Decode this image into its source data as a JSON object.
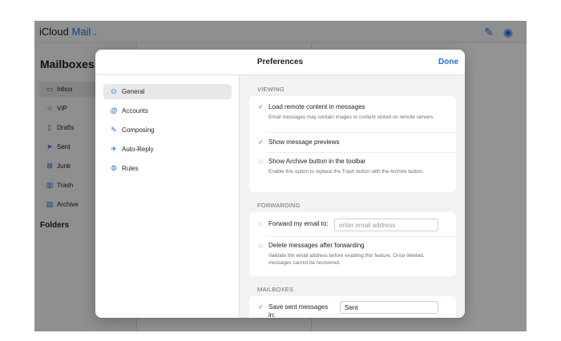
{
  "app": {
    "brand_prefix": "iCloud",
    "brand_product": "Mail",
    "brand_chevron": "⌄",
    "mailboxes_title": "Mailboxes",
    "folders_title": "Folders",
    "mailboxes": [
      {
        "label": "Inbox",
        "icon": "inbox-icon",
        "glyph": "▭"
      },
      {
        "label": "VIP",
        "icon": "star-icon",
        "glyph": "☆"
      },
      {
        "label": "Drafts",
        "icon": "draft-icon",
        "glyph": "▯"
      },
      {
        "label": "Sent",
        "icon": "paper-plane-icon",
        "glyph": "➤"
      },
      {
        "label": "Junk",
        "icon": "junk-icon",
        "glyph": "⊠"
      },
      {
        "label": "Trash",
        "icon": "trash-icon",
        "glyph": "▥"
      },
      {
        "label": "Archive",
        "icon": "archive-icon",
        "glyph": "▤"
      }
    ]
  },
  "modal": {
    "title": "Preferences",
    "done_label": "Done",
    "nav": [
      {
        "label": "General",
        "icon": "gear-icon",
        "glyph": "⊙"
      },
      {
        "label": "Accounts",
        "icon": "at-icon",
        "glyph": "@"
      },
      {
        "label": "Composing",
        "icon": "compose-icon",
        "glyph": "✎"
      },
      {
        "label": "Auto-Reply",
        "icon": "plane-icon",
        "glyph": "✈"
      },
      {
        "label": "Rules",
        "icon": "rules-icon",
        "glyph": "⚙"
      }
    ]
  },
  "viewing": {
    "header": "VIEWING",
    "load_remote": {
      "label": "Load remote content in messages",
      "checked": true,
      "desc": "Email messages may contain images or content stored on remote servers."
    },
    "previews": {
      "label": "Show message previews",
      "checked": true
    },
    "archive_btn": {
      "label": "Show Archive button in the toolbar",
      "checked": false,
      "desc": "Enable this option to replace the Trash button with the Archive button."
    }
  },
  "forwarding": {
    "header": "FORWARDING",
    "forward": {
      "label": "Forward my email to:",
      "checked": false,
      "placeholder": "enter email address"
    },
    "delete_after": {
      "label": "Delete messages after forwarding",
      "checked": false,
      "desc": "Validate the email address before enabling this feature. Once deleted, messages cannot be recovered."
    }
  },
  "mailboxes_section": {
    "header": "MAILBOXES",
    "save_sent": {
      "label_line1": "Save sent messages",
      "label_line2": "in:",
      "checked": true,
      "value": "Sent"
    }
  },
  "glyphs": {
    "check": "✓"
  },
  "colors": {
    "accent": "#1a73e8",
    "scrim": "rgba(0,0,0,0.42)"
  }
}
